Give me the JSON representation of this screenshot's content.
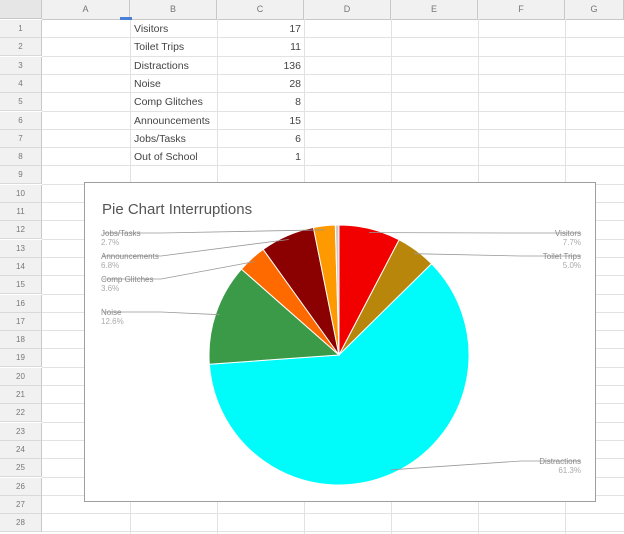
{
  "columns": [
    "A",
    "B",
    "C",
    "D",
    "E",
    "F",
    "G"
  ],
  "rows": [
    "1",
    "2",
    "3",
    "4",
    "5",
    "6",
    "7",
    "8",
    "9",
    "10",
    "11",
    "12",
    "13",
    "14",
    "15",
    "16",
    "17",
    "18",
    "19",
    "20",
    "21",
    "22",
    "23",
    "24",
    "25",
    "26",
    "27",
    "28"
  ],
  "table": [
    {
      "label": "Visitors",
      "value": "17"
    },
    {
      "label": "Toilet Trips",
      "value": "11"
    },
    {
      "label": "Distractions",
      "value": "136"
    },
    {
      "label": "Noise",
      "value": "28"
    },
    {
      "label": "Comp Glitches",
      "value": "8"
    },
    {
      "label": "Announcements",
      "value": "15"
    },
    {
      "label": "Jobs/Tasks",
      "value": "6"
    },
    {
      "label": "Out of School",
      "value": "1"
    }
  ],
  "chart_data": {
    "type": "pie",
    "title": "Pie Chart Interruptions",
    "slices": [
      {
        "label": "Visitors",
        "value": 17,
        "percent": "7.7%",
        "color": "#f20000",
        "side": "right"
      },
      {
        "label": "Toilet Trips",
        "value": 11,
        "percent": "5.0%",
        "color": "#b8860b",
        "side": "right"
      },
      {
        "label": "Distractions",
        "value": 136,
        "percent": "61.3%",
        "color": "#00fbfb",
        "side": "right"
      },
      {
        "label": "Noise",
        "value": 28,
        "percent": "12.6%",
        "color": "#3a9a48",
        "side": "left"
      },
      {
        "label": "Comp Glitches",
        "value": 8,
        "percent": "3.6%",
        "color": "#ff6a00",
        "side": "left"
      },
      {
        "label": "Announcements",
        "value": 15,
        "percent": "6.8%",
        "color": "#8b0000",
        "side": "left"
      },
      {
        "label": "Jobs/Tasks",
        "value": 6,
        "percent": "2.7%",
        "color": "#ff9900",
        "side": "left"
      },
      {
        "label": "Out of School",
        "value": 1,
        "percent": "",
        "color": "#cccccc",
        "side": "none"
      }
    ]
  }
}
